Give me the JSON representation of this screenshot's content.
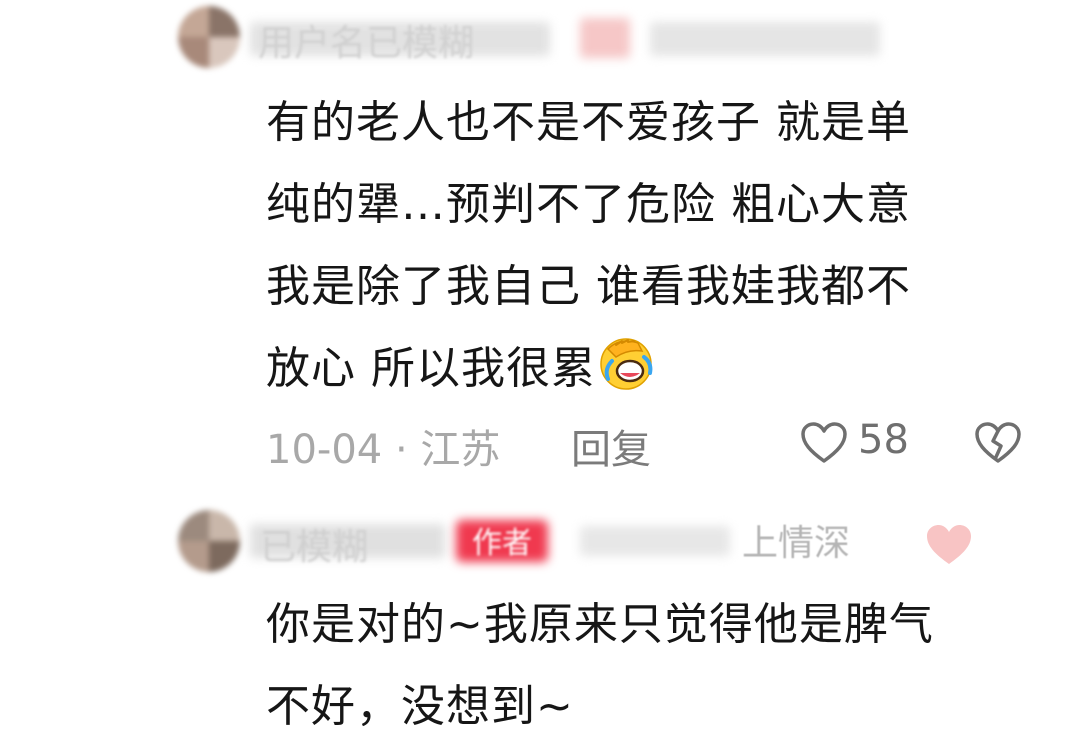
{
  "comments": [
    {
      "author": "用户名已模糊",
      "text_lines": [
        "有的老人也不是不爱孩子  就是单",
        "纯的犟…预判不了危险 粗心大意",
        "我是除了我自己  谁看我娃我都不",
        "放心  所以我很累"
      ],
      "emoji": "facepalm-crying-emoji",
      "date": "10-04",
      "separator": " · ",
      "location": "江苏",
      "reply_label": "回复",
      "like_count": "58",
      "like_icon": "heart-outline-icon",
      "dislike_icon": "broken-heart-icon"
    },
    {
      "author_tail": "上情深",
      "author_blurred": "已模糊",
      "badge": "作者",
      "text_lines": [
        "你是对的~我原来只觉得他是脾气",
        "不好，没想到~"
      ],
      "like_icon": "heart-filled-pink-icon"
    }
  ],
  "colors": {
    "text_primary": "#161616",
    "text_meta": "#a8a8a8",
    "reply_gray": "#7b7b7b",
    "badge_red": "#f0394f",
    "heart_pink": "#f8c4c4"
  }
}
